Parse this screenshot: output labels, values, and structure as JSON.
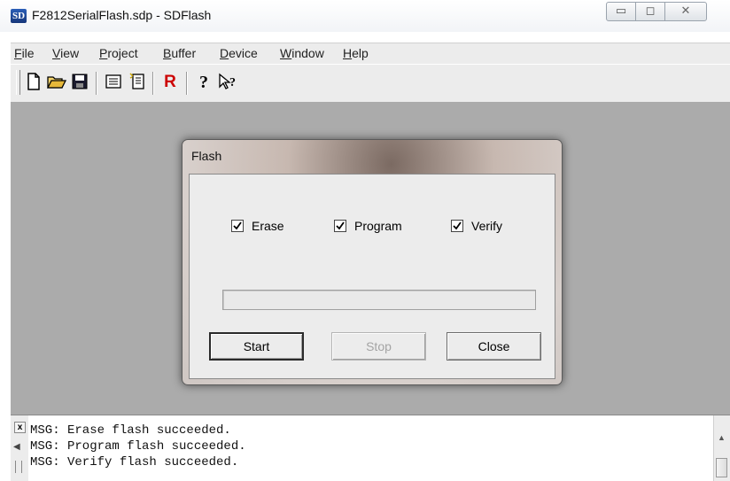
{
  "window": {
    "icon_label": "SD",
    "title": "F2812SerialFlash.sdp - SDFlash",
    "controls": {
      "minimize": "▭",
      "maximize": "◻",
      "close": "✕"
    }
  },
  "menu": [
    "File",
    "View",
    "Project",
    "Buffer",
    "Device",
    "Window",
    "Help"
  ],
  "toolbar": {
    "buttons": [
      {
        "name": "new-file-icon",
        "glyph": "🗋"
      },
      {
        "name": "open-folder-icon",
        "glyph": "📂"
      },
      {
        "name": "save-icon",
        "glyph": "💾"
      },
      {
        "name": "list-view-icon",
        "glyph": "▤"
      },
      {
        "name": "flash-memory-icon",
        "glyph": "⌹"
      },
      {
        "name": "reset-icon",
        "glyph": "R"
      },
      {
        "name": "help-icon",
        "glyph": "?"
      },
      {
        "name": "context-help-icon",
        "glyph": "↖?"
      }
    ],
    "reset_color": "#cc0000"
  },
  "dialog": {
    "title": "Flash",
    "checks": [
      {
        "label": "Erase",
        "checked": true
      },
      {
        "label": "Program",
        "checked": true
      },
      {
        "label": "Verify",
        "checked": true
      }
    ],
    "progress_percent": 0,
    "buttons": {
      "start": "Start",
      "stop": "Stop",
      "close": "Close"
    }
  },
  "output": {
    "close_glyph": "x",
    "lines": [
      "MSG: Erase flash succeeded.",
      "MSG: Program flash succeeded.",
      "MSG: Verify flash succeeded."
    ]
  }
}
